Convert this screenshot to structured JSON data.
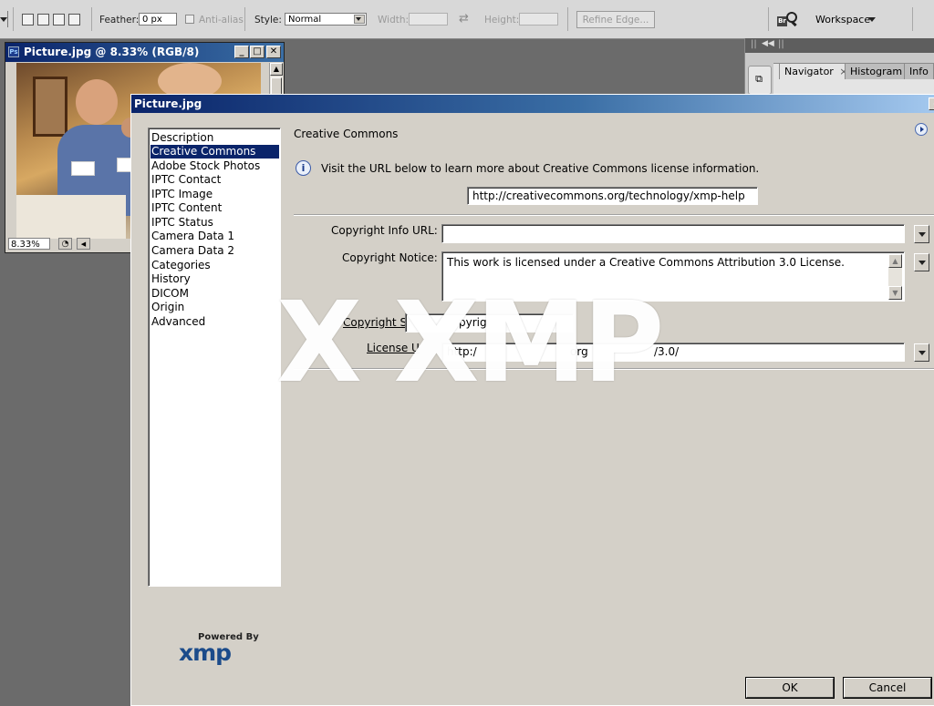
{
  "options_bar": {
    "feather_label": "Feather:",
    "feather_value": "0 px",
    "antialias_label": "Anti-alias",
    "style_label": "Style:",
    "style_value": "Normal",
    "width_label": "Width:",
    "height_label": "Height:",
    "refine_edge_label": "Refine Edge...",
    "workspace_label": "Workspace"
  },
  "document_window": {
    "title": "Picture.jpg @ 8.33% (RGB/8)",
    "zoom_value": "8.33%"
  },
  "panels": {
    "tabs": [
      {
        "label": "Navigator"
      },
      {
        "label": "Histogram"
      },
      {
        "label": "Info"
      }
    ],
    "close_glyph": "×"
  },
  "dialog": {
    "title": "Picture.jpg",
    "categories": [
      "Description",
      "Creative Commons",
      "Adobe Stock Photos",
      "IPTC Contact",
      "IPTC Image",
      "IPTC Content",
      "IPTC Status",
      "Camera Data 1",
      "Camera Data 2",
      "Categories",
      "History",
      "DICOM",
      "Origin",
      "Advanced"
    ],
    "selected_category": "Creative Commons",
    "section_title": "Creative Commons",
    "info_text": "Visit the URL below to learn more about Creative Commons license information.",
    "help_url": "http://creativecommons.org/technology/xmp-help",
    "copyright_info_url_label": "Copyright Info URL:",
    "copyright_info_url_value": "",
    "copyright_notice_label": "Copyright Notice:",
    "copyright_notice_value": "This work is licensed under a Creative Commons Attribution 3.0  License.",
    "copyright_status_label_visible": "Copyright S",
    "copyright_status_value_visible": "pyrig",
    "license_url_label_visible": "License U",
    "license_url_value_visible_parts": [
      "http:/",
      "org",
      "/3.0/"
    ],
    "powered_by": "Powered By",
    "xmp_logo": "xmp",
    "ok_label": "OK",
    "cancel_label": "Cancel"
  },
  "watermark": "X XMP"
}
